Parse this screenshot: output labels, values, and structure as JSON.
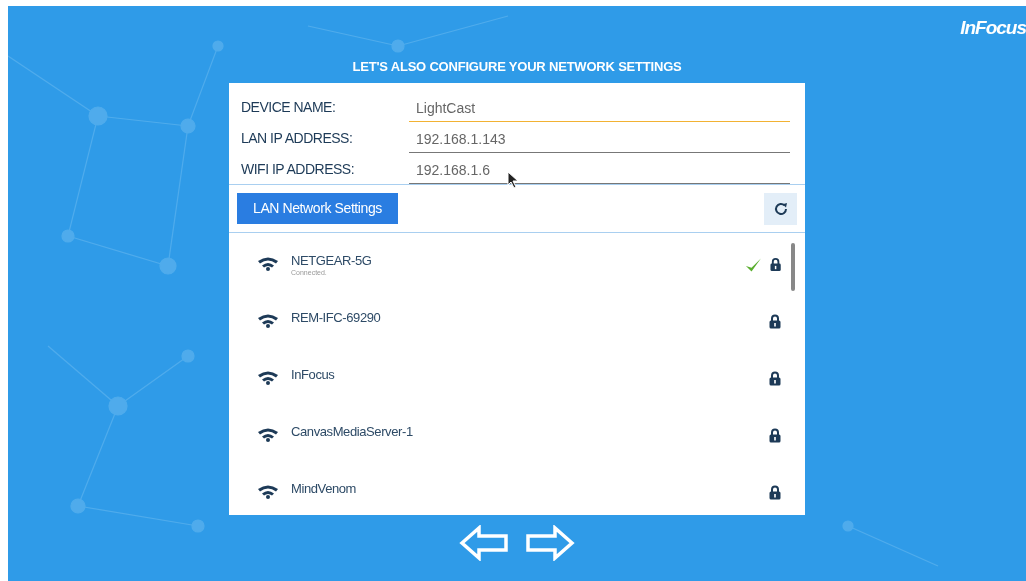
{
  "logo": "InFocus",
  "heading": "LET'S ALSO CONFIGURE YOUR NETWORK SETTINGS",
  "fields": [
    {
      "label": "DEVICE NAME:",
      "value": "LightCast",
      "focused": true
    },
    {
      "label": "LAN IP ADDRESS:",
      "value": "192.168.1.143",
      "focused": false
    },
    {
      "label": "WIFI IP ADDRESS:",
      "value": "192.168.1.6",
      "focused": false
    }
  ],
  "lan_button": "LAN Network Settings",
  "networks": [
    {
      "name": "NETGEAR-5G",
      "status": "Connected.",
      "connected": true,
      "locked": true
    },
    {
      "name": "REM-IFC-69290",
      "connected": false,
      "locked": true
    },
    {
      "name": "InFocus",
      "connected": false,
      "locked": true
    },
    {
      "name": "CanvasMediaServer-1",
      "connected": false,
      "locked": true
    },
    {
      "name": "MindVenom",
      "connected": false,
      "locked": true
    }
  ]
}
